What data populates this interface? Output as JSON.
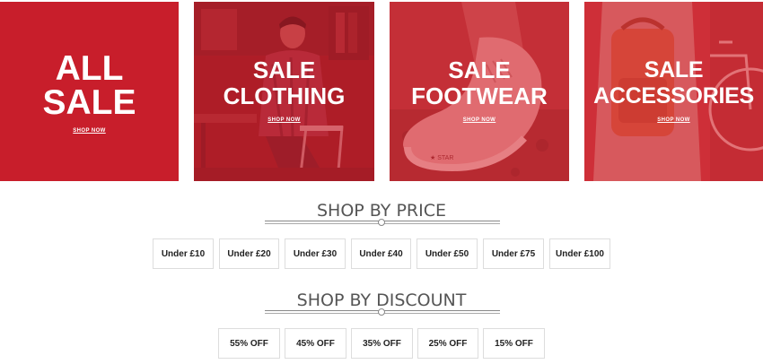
{
  "tiles": [
    {
      "title_lines": [
        "ALL",
        "SALE"
      ],
      "link": "SHOP NOW",
      "color": "#c81e2b",
      "photo": "none"
    },
    {
      "title_lines": [
        "SALE",
        "CLOTHING"
      ],
      "link": "SHOP NOW",
      "color": "#c81e2b",
      "photo": "man-seated-on-chair"
    },
    {
      "title_lines": [
        "SALE",
        "FOOTWEAR"
      ],
      "link": "SHOP NOW",
      "color": "#d12a34",
      "photo": "sneaker-foot"
    },
    {
      "title_lines": [
        "SALE",
        "ACCESSORIES"
      ],
      "link": "SHOP NOW",
      "color": "#d02a33",
      "photo": "backpack-and-bicycle"
    }
  ],
  "shop_by_price": {
    "title": "SHOP BY PRICE",
    "buttons": [
      "Under £10",
      "Under £20",
      "Under £30",
      "Under £40",
      "Under £50",
      "Under £75",
      "Under £100"
    ]
  },
  "shop_by_discount": {
    "title": "SHOP BY DISCOUNT",
    "buttons": [
      "55% OFF",
      "45% OFF",
      "35% OFF",
      "25% OFF",
      "15% OFF"
    ]
  },
  "colors": {
    "sale_red": "#c81e2b",
    "heading_text": "#555555",
    "button_border": "#dddddd",
    "button_text": "#222222"
  }
}
